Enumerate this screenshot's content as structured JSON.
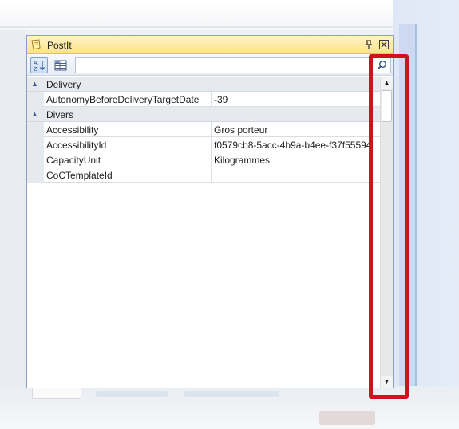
{
  "window": {
    "title": "PostIt",
    "pin_icon": "pin-icon",
    "close_icon": "close-icon"
  },
  "toolbar": {
    "sort_icon": "sort-az-icon",
    "categorize_icon": "categorize-icon",
    "search_value": "",
    "search_placeholder": "",
    "search_icon": "search-icon"
  },
  "grid": {
    "categories": [
      {
        "label": "Delivery",
        "expanded": true,
        "properties": [
          {
            "name": "AutonomyBeforeDeliveryTargetDate",
            "value": "-39"
          }
        ]
      },
      {
        "label": "Divers",
        "expanded": true,
        "properties": [
          {
            "name": "Accessibility",
            "value": "Gros porteur"
          },
          {
            "name": "AccessibilityId",
            "value": "f0579cb8-5acc-4b9a-b4ee-f37f55594"
          },
          {
            "name": "CapacityUnit",
            "value": "Kilogrammes"
          },
          {
            "name": "CoCTemplateId",
            "value": ""
          }
        ]
      }
    ]
  },
  "colors": {
    "title_bar": "#fbe28c",
    "highlight": "#d0121f",
    "category_bg": "#e6e9ee"
  }
}
